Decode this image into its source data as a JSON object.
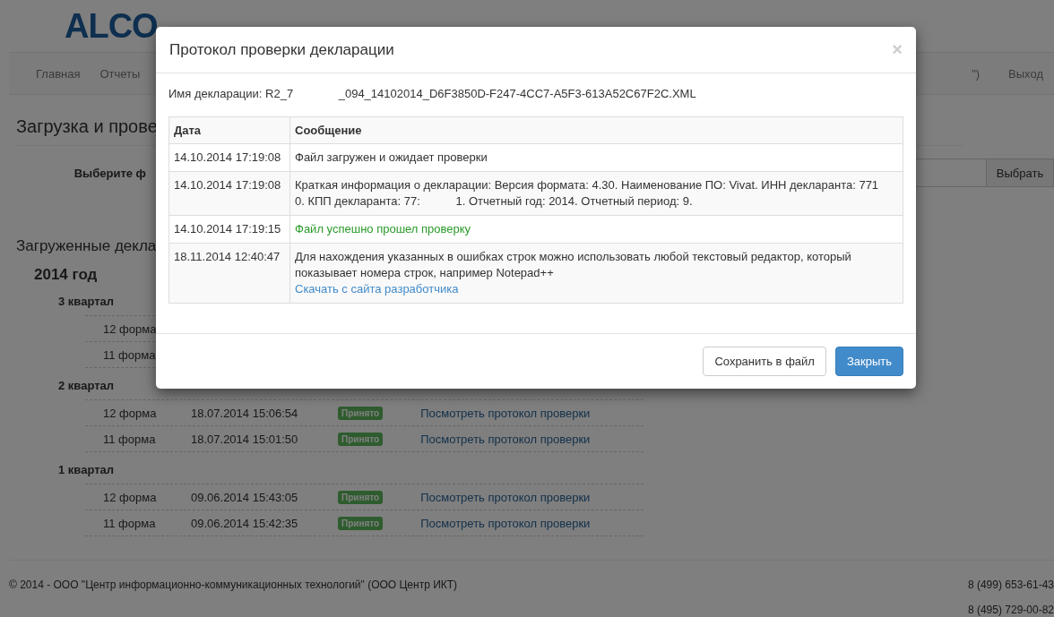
{
  "header": {
    "logo_main": "ALCO"
  },
  "nav": {
    "items": [
      {
        "label": "Главная"
      },
      {
        "label": "Отчеты"
      }
    ],
    "user": "\")",
    "logout": "Выход"
  },
  "upload": {
    "heading": "Загрузка и прове",
    "file_label": "Выберите ф",
    "browse_button": "Выбрать"
  },
  "declarations": {
    "heading": "Загруженные декла",
    "years": [
      {
        "year": "2014 год",
        "quarters": [
          {
            "name": "3 квартал",
            "rows": [
              {
                "form": "12 форма"
              },
              {
                "form": "11 форма"
              }
            ]
          },
          {
            "name": "2 квартал",
            "rows": [
              {
                "form": "12 форма",
                "date": "18.07.2014 15:06:54",
                "status": "Принято",
                "link": "Посмотреть протокол проверки"
              },
              {
                "form": "11 форма",
                "date": "18.07.2014 15:01:50",
                "status": "Принято",
                "link": "Посмотреть протокол проверки"
              }
            ]
          },
          {
            "name": "1 квартал",
            "rows": [
              {
                "form": "12 форма",
                "date": "09.06.2014 15:43:05",
                "status": "Принято",
                "link": "Посмотреть протокол проверки"
              },
              {
                "form": "11 форма",
                "date": "09.06.2014 15:42:35",
                "status": "Принято",
                "link": "Посмотреть протокол проверки"
              }
            ]
          }
        ]
      }
    ]
  },
  "footer": {
    "copyright": "© 2014 - ООО \"Центр информационно-коммуникационных технологий\" (ООО Центр ИКТ)",
    "phones": [
      "8 (499) 653-61-43",
      "8 (495) 729-00-82"
    ]
  },
  "modal": {
    "title": "Протокол проверки декларации",
    "close": "×",
    "file_name": "Имя декларации: R2_7              _094_14102014_D6F3850D-F247-4CC7-A5F3-613A52C67F2C.XML",
    "columns": [
      "Дата",
      "Сообщение"
    ],
    "rows": [
      {
        "date": "14.10.2014 17:19:08",
        "kind": "normal",
        "text": "Файл загружен и ожидает проверки"
      },
      {
        "date": "14.10.2014 17:19:08",
        "kind": "normal",
        "text": "Краткая информация о декларации: Версия формата: 4.30. Наименование ПО: Vivat. ИНН декларанта: 771            0. КПП декларанта: 77:           1. Отчетный год: 2014. Отчетный период: 9."
      },
      {
        "date": "14.10.2014 17:19:15",
        "kind": "success",
        "text": "Файл успешно прошел проверку"
      },
      {
        "date": "18.11.2014 12:40:47",
        "kind": "normal",
        "text": "Для нахождения указанных в ошибках строк можно использовать любой текстовый редактор, который показывает номера строк, например Notepad++",
        "link": "Скачать с сайта разработчика"
      }
    ],
    "buttons": [
      {
        "label": "Сохранить в файл",
        "kind": "default"
      },
      {
        "label": "Закрыть",
        "kind": "primary"
      }
    ]
  }
}
